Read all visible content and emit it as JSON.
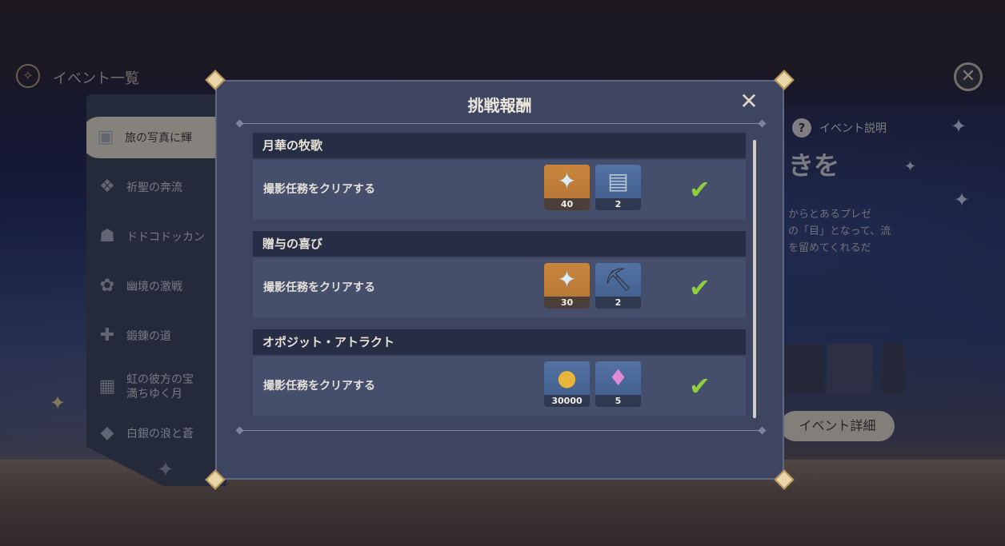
{
  "header": {
    "title": "イベント一覧",
    "compass_icon": "compass-icon",
    "close_icon": "close-icon"
  },
  "sidebar": {
    "items": [
      {
        "label": "旅の写真に輝",
        "icon": "camera-icon",
        "active": true
      },
      {
        "label": "祈聖の奔流",
        "icon": "emblem-icon"
      },
      {
        "label": "ドドコドッカン",
        "icon": "dodoco-icon"
      },
      {
        "label": "幽境の激戦",
        "icon": "flower-icon"
      },
      {
        "label": "鍛錬の道",
        "icon": "training-icon"
      },
      {
        "label": "虹の彼方の宝",
        "label2": "満ちゆく月",
        "icon": "calendar-icon"
      },
      {
        "label": "白銀の浪と蒼",
        "icon": "diamond-icon"
      }
    ]
  },
  "background_panel": {
    "help_label": "イベント説明",
    "heading": "きを",
    "desc_lines": [
      "からとあるプレゼ",
      "の「目」となって、流",
      "を留めてくれるだ"
    ],
    "detail_button": "イベント詳細"
  },
  "modal": {
    "title": "挑戦報酬",
    "sections": [
      {
        "header": "月華の牧歌",
        "task": "撮影任務をクリアする",
        "rewards": [
          {
            "name": "primogem",
            "count": "40",
            "bg": "orange"
          },
          {
            "name": "heros-wit-book",
            "count": "2",
            "bg": "blue"
          }
        ],
        "completed": true
      },
      {
        "header": "贈与の喜び",
        "task": "撮影任務をクリアする",
        "rewards": [
          {
            "name": "primogem",
            "count": "30",
            "bg": "orange"
          },
          {
            "name": "mystic-enhancement-ore",
            "count": "2",
            "bg": "blue"
          }
        ],
        "completed": true
      },
      {
        "header": "オポジット・アトラクト",
        "task": "撮影任務をクリアする",
        "rewards": [
          {
            "name": "mora",
            "count": "30000",
            "bg": "blue"
          },
          {
            "name": "crystal",
            "count": "5",
            "bg": "blue"
          }
        ],
        "completed": true
      }
    ]
  },
  "colors": {
    "accent_green": "#8fcf3e",
    "modal_bg": "#3d4560",
    "reward_orange": "#c8863c",
    "reward_blue": "#4a6798"
  }
}
